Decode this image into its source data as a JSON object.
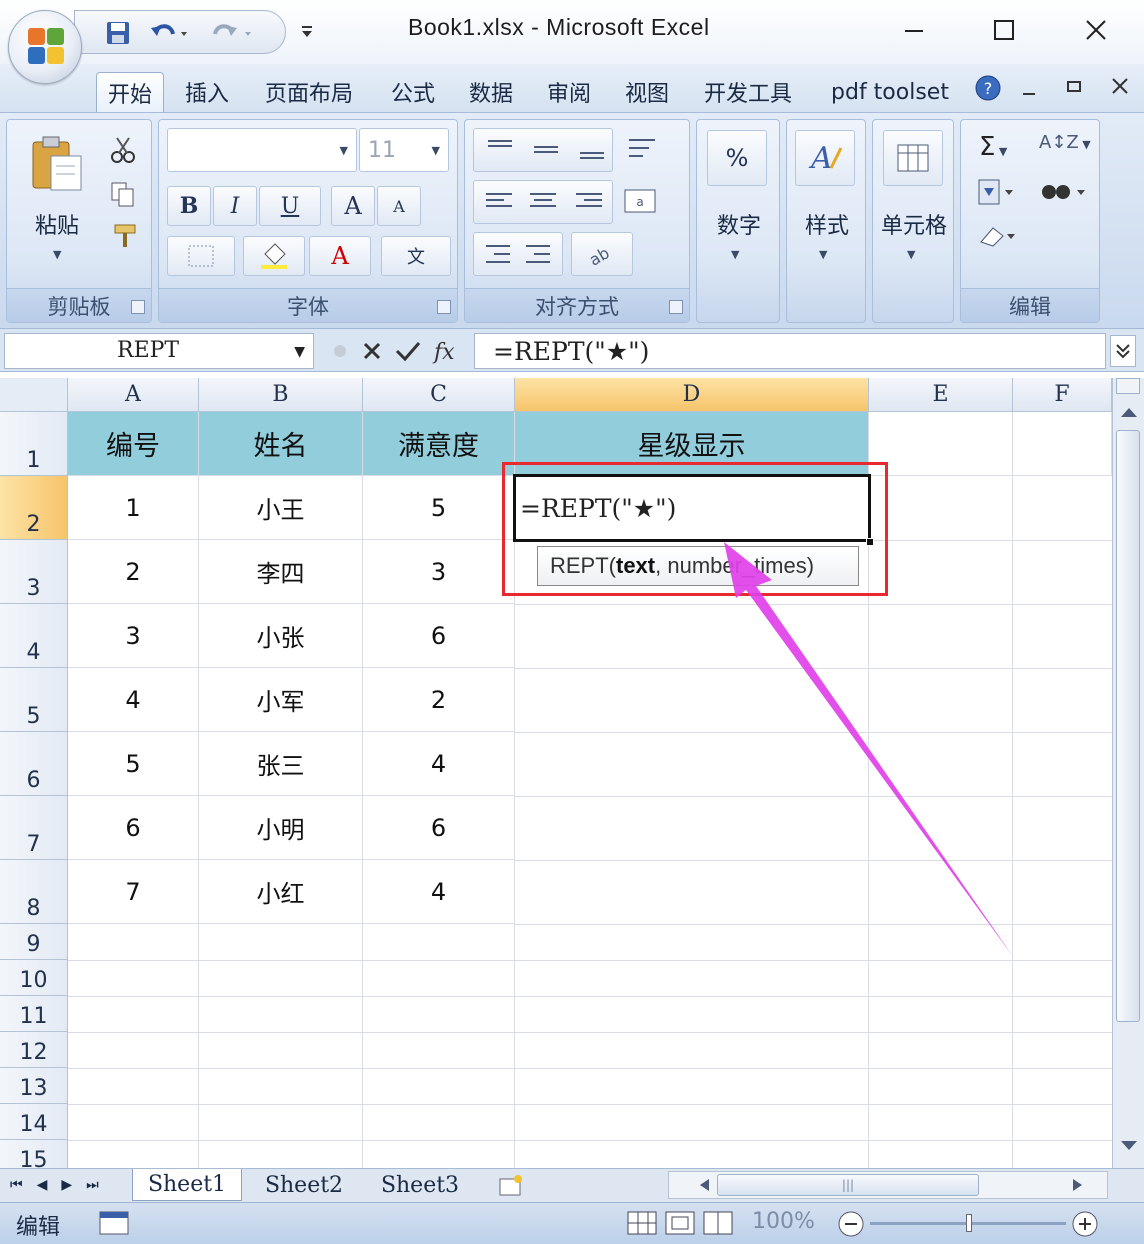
{
  "window": {
    "title": "Book1.xlsx  -  Microsoft Excel",
    "minimize_icon": "minimize-icon",
    "maximize_icon": "maximize-icon",
    "close_icon": "close-icon"
  },
  "tabs": [
    {
      "label": "开始",
      "active": true
    },
    {
      "label": "插入"
    },
    {
      "label": "页面布局"
    },
    {
      "label": "公式"
    },
    {
      "label": "数据"
    },
    {
      "label": "审阅"
    },
    {
      "label": "视图"
    },
    {
      "label": "开发工具"
    },
    {
      "label": "pdf toolset"
    }
  ],
  "ribbon": {
    "clipboard": {
      "label": "剪贴板",
      "paste_label": "粘贴"
    },
    "font": {
      "label": "字体",
      "font_name": "",
      "font_size": "11"
    },
    "alignment": {
      "label": "对齐方式"
    },
    "number": {
      "label": "数字",
      "button": "%"
    },
    "styles": {
      "label": "样式"
    },
    "cells": {
      "label": "单元格"
    },
    "editing": {
      "label": "编辑"
    }
  },
  "formula_bar": {
    "name_box": "REPT",
    "formula": "=REPT(\"★\")"
  },
  "grid": {
    "columns": [
      "A",
      "B",
      "C",
      "D",
      "E",
      "F"
    ],
    "rows": [
      "1",
      "2",
      "3",
      "4",
      "5",
      "6",
      "7",
      "8",
      "9",
      "10",
      "11",
      "12",
      "13",
      "14",
      "15"
    ],
    "header_row": [
      "编号",
      "姓名",
      "满意度",
      "星级显示"
    ],
    "data": [
      [
        "1",
        "小王",
        "5"
      ],
      [
        "2",
        "李四",
        "3"
      ],
      [
        "3",
        "小张",
        "6"
      ],
      [
        "4",
        "小军",
        "2"
      ],
      [
        "5",
        "张三",
        "4"
      ],
      [
        "6",
        "小明",
        "6"
      ],
      [
        "7",
        "小红",
        "4"
      ]
    ],
    "active_cell": "D2",
    "editing_text": "=REPT(\"★\")",
    "tooltip_func": "REPT(",
    "tooltip_arg1": "text",
    "tooltip_rest": ", number_times)"
  },
  "sheets": [
    "Sheet1",
    "Sheet2",
    "Sheet3"
  ],
  "status": {
    "mode": "编辑",
    "zoom": "100%"
  },
  "colors": {
    "header_fill": "#92cddc",
    "annotation_red": "#e8292f",
    "arrow_magenta": "#e040e8"
  }
}
